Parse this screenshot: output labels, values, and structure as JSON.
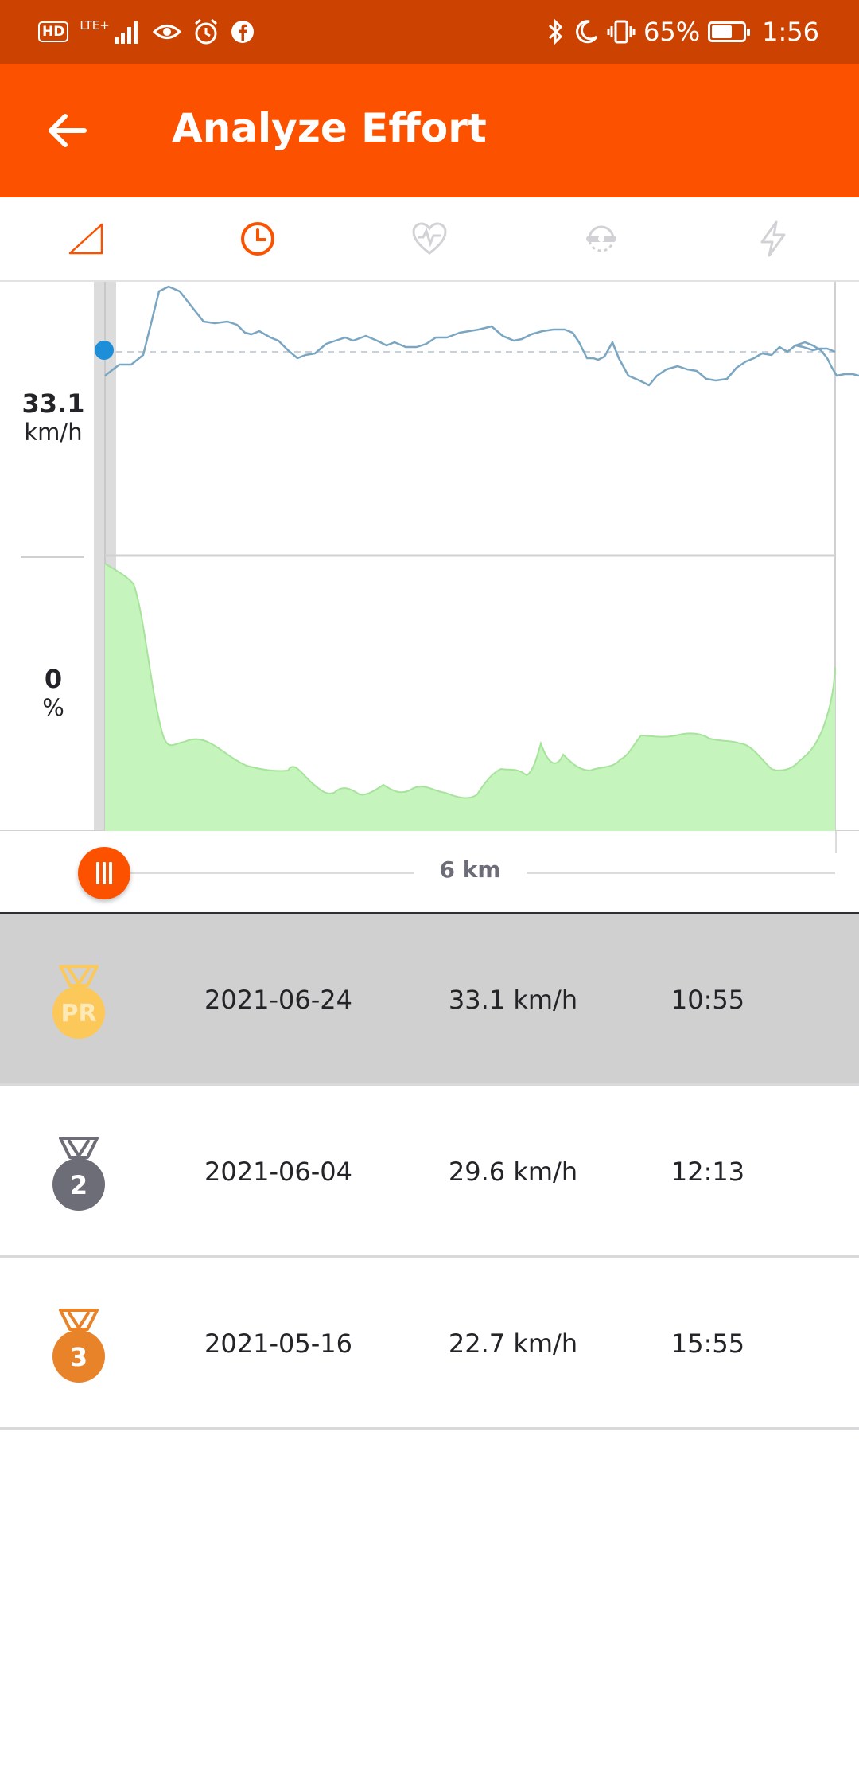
{
  "status_bar": {
    "hd": "HD",
    "network": "LTE+",
    "battery_percent": "65%",
    "battery_level": 0.65,
    "time": "1:56"
  },
  "header": {
    "title": "Analyze Effort",
    "back_icon": "arrow-left-icon"
  },
  "metric_tabs": [
    {
      "icon": "elevation-icon",
      "active": false
    },
    {
      "icon": "clock-icon",
      "active": true
    },
    {
      "icon": "heart-rate-icon",
      "active": false
    },
    {
      "icon": "cadence-icon",
      "active": false
    },
    {
      "icon": "power-icon",
      "active": false
    }
  ],
  "chart": {
    "speed_value": "33.1",
    "speed_unit": "km/h",
    "grade_value": "0",
    "grade_unit": "%",
    "speed_color": "#7aa6c2",
    "grade_color": "#c5f5bc"
  },
  "slider": {
    "distance_label": "6 km"
  },
  "efforts": [
    {
      "rank": "PR",
      "medal_color": "#fcc85a",
      "date": "2021-06-24",
      "speed": "33.1 km/h",
      "time": "10:55",
      "selected": true
    },
    {
      "rank": "2",
      "medal_color": "#6d6d78",
      "date": "2021-06-04",
      "speed": "29.6 km/h",
      "time": "12:13",
      "selected": false
    },
    {
      "rank": "3",
      "medal_color": "#e8832a",
      "date": "2021-05-16",
      "speed": "22.7 km/h",
      "time": "15:55",
      "selected": false
    }
  ],
  "colors": {
    "brand": "#fc5200",
    "status_bar": "#cc4200",
    "selected_row": "#d0d0d0"
  }
}
